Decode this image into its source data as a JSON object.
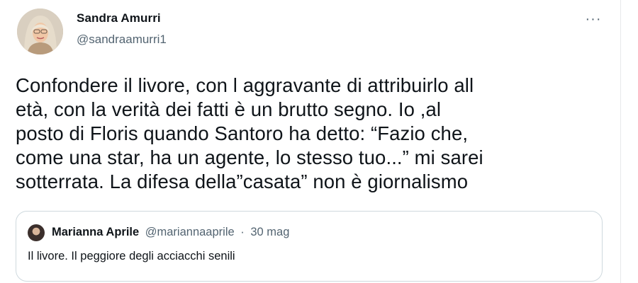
{
  "author": {
    "name": "Sandra Amurri",
    "handle": "@sandraamurri1"
  },
  "more_icon": "more-horizontal-icon",
  "more_glyph": "···",
  "tweet_text": "Confondere il livore, con l aggravante di attribuirlo all\netà,  con la verità dei fatti è un brutto segno. Io ,al\nposto di Floris quando Santoro ha detto: “Fazio che,\ncome una star, ha un agente, lo stesso tuo...” mi sarei\nsotterrata. La difesa della”casata” non è giornalismo",
  "quoted": {
    "name": "Marianna Aprile",
    "handle": "@mariannaaprile",
    "separator": "·",
    "date": "30 mag",
    "text": "Il livore. Il peggiore degli acciacchi senili"
  },
  "colors": {
    "text": "#0f1419",
    "secondary": "#536471",
    "border": "#cfd9de"
  }
}
